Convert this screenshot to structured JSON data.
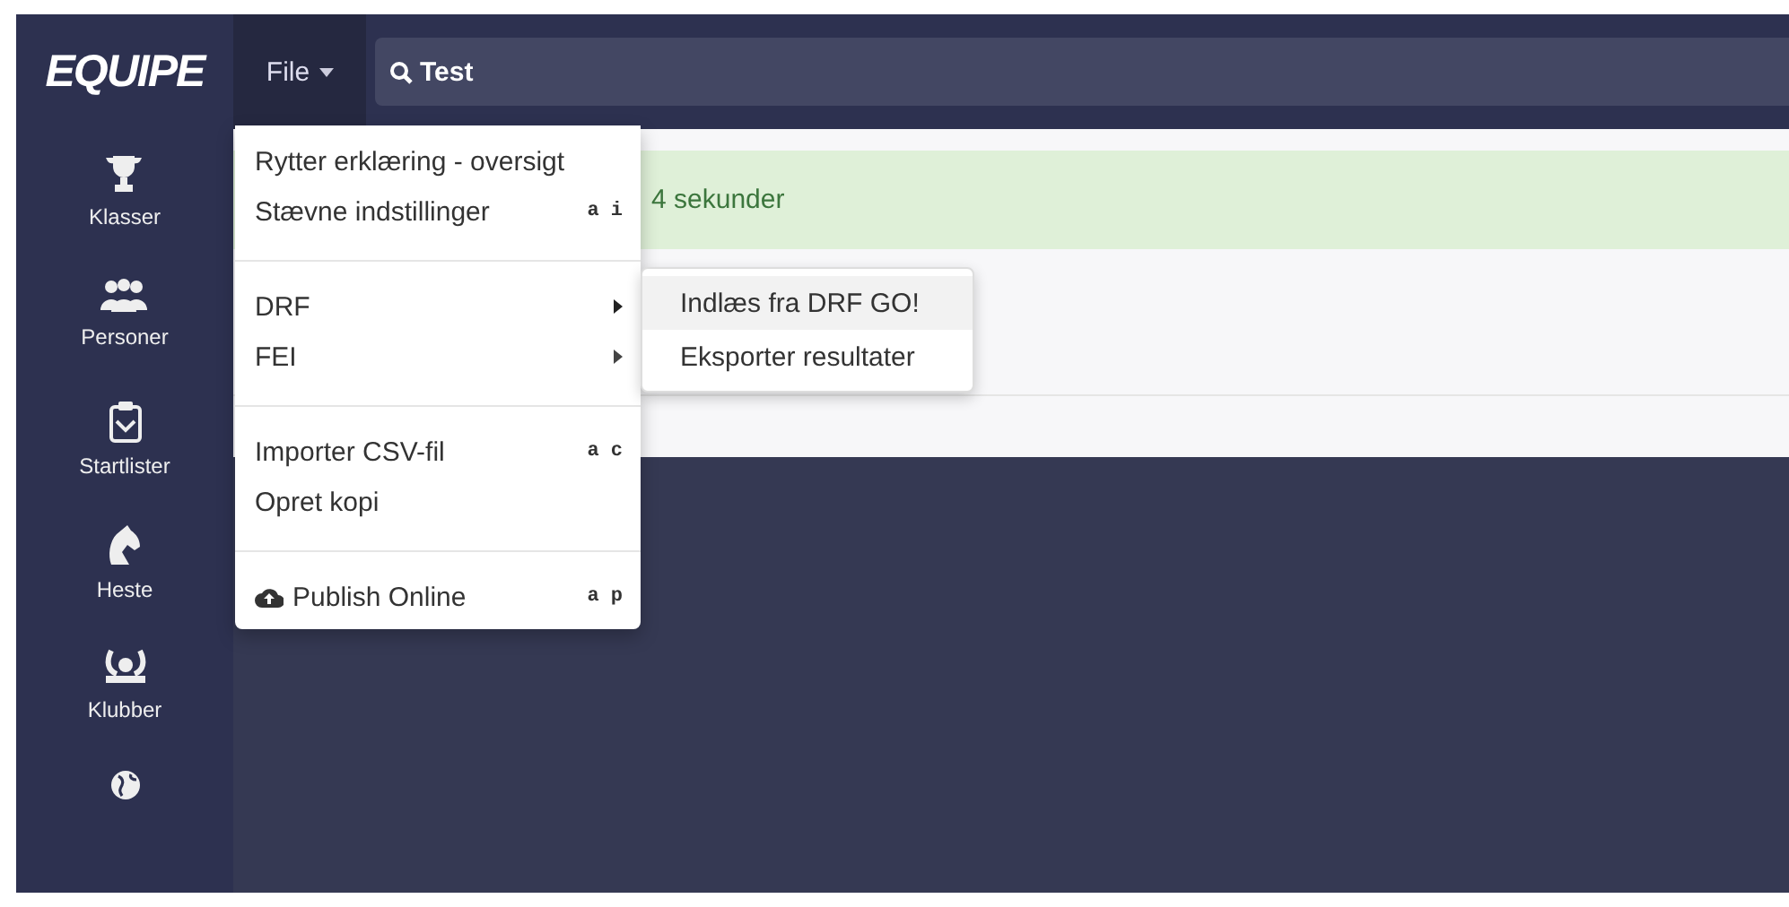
{
  "logo": {
    "text": "EQUIPE"
  },
  "menu_button": {
    "label": "File",
    "expanded": true
  },
  "search": {
    "value": "Test"
  },
  "sidebar": {
    "items": [
      {
        "kind": "trophy",
        "label": "Klasser"
      },
      {
        "kind": "people",
        "label": "Personer"
      },
      {
        "kind": "clipboard",
        "label": "Startlister"
      },
      {
        "kind": "horse",
        "label": "Heste"
      },
      {
        "kind": "horseshoe",
        "label": "Klubber"
      },
      {
        "kind": "globe"
      }
    ]
  },
  "alert": {
    "text": "4 sekunder"
  },
  "file_menu": {
    "groups": [
      [
        {
          "label": "Rytter erklæring - oversigt"
        },
        {
          "label": "Stævne indstillinger",
          "shortcut": "a i"
        }
      ],
      [
        {
          "label": "DRF",
          "kind": "submenu",
          "expanded": true
        },
        {
          "label": "FEI",
          "kind": "submenu",
          "expanded": false
        }
      ],
      [
        {
          "label": "Importer CSV-fil",
          "shortcut": "a c"
        },
        {
          "label": "Opret kopi"
        }
      ],
      [
        {
          "label": "Publish Online",
          "kind": "cloud",
          "shortcut": "a p"
        }
      ]
    ]
  },
  "submenu": {
    "items": [
      {
        "label": "Indlæs fra DRF GO!",
        "selected": true
      },
      {
        "label": "Eksporter resultater",
        "selected": false
      }
    ]
  }
}
